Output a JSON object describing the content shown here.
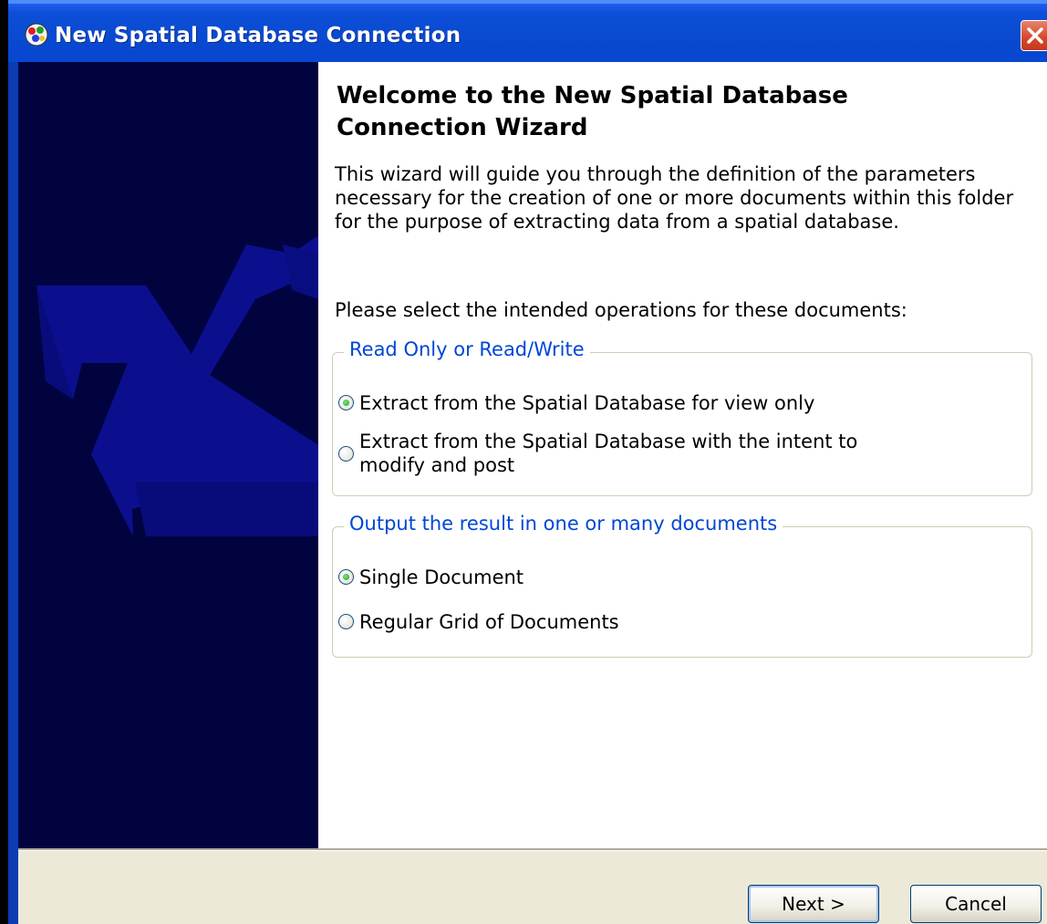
{
  "window": {
    "title": "New Spatial Database Connection"
  },
  "content": {
    "heading": "Welcome to the New Spatial Database Connection Wizard",
    "description": "This wizard will guide you through the definition of the parameters necessary for the creation of one or more documents within this folder for the purpose of extracting data from a spatial database.",
    "prompt": "Please select the intended operations for these documents:"
  },
  "group_read_write": {
    "legend": "Read Only or Read/Write",
    "options": [
      {
        "label": "Extract from the Spatial Database for view only",
        "checked": true
      },
      {
        "label": "Extract from the Spatial Database with the intent to modify and post",
        "checked": false
      }
    ]
  },
  "group_output": {
    "legend": "Output the result in one or many documents",
    "options": [
      {
        "label": "Single Document",
        "checked": true
      },
      {
        "label": "Regular Grid of Documents",
        "checked": false
      }
    ]
  },
  "buttons": {
    "next": "Next >",
    "cancel": "Cancel"
  },
  "colors": {
    "titlebar": "#0a4ad1",
    "banner": "#01033f",
    "banner_arrows": "#0b0f8e",
    "group_legend_text": "#0046d5",
    "dialog_bottom": "#ece9d8"
  }
}
